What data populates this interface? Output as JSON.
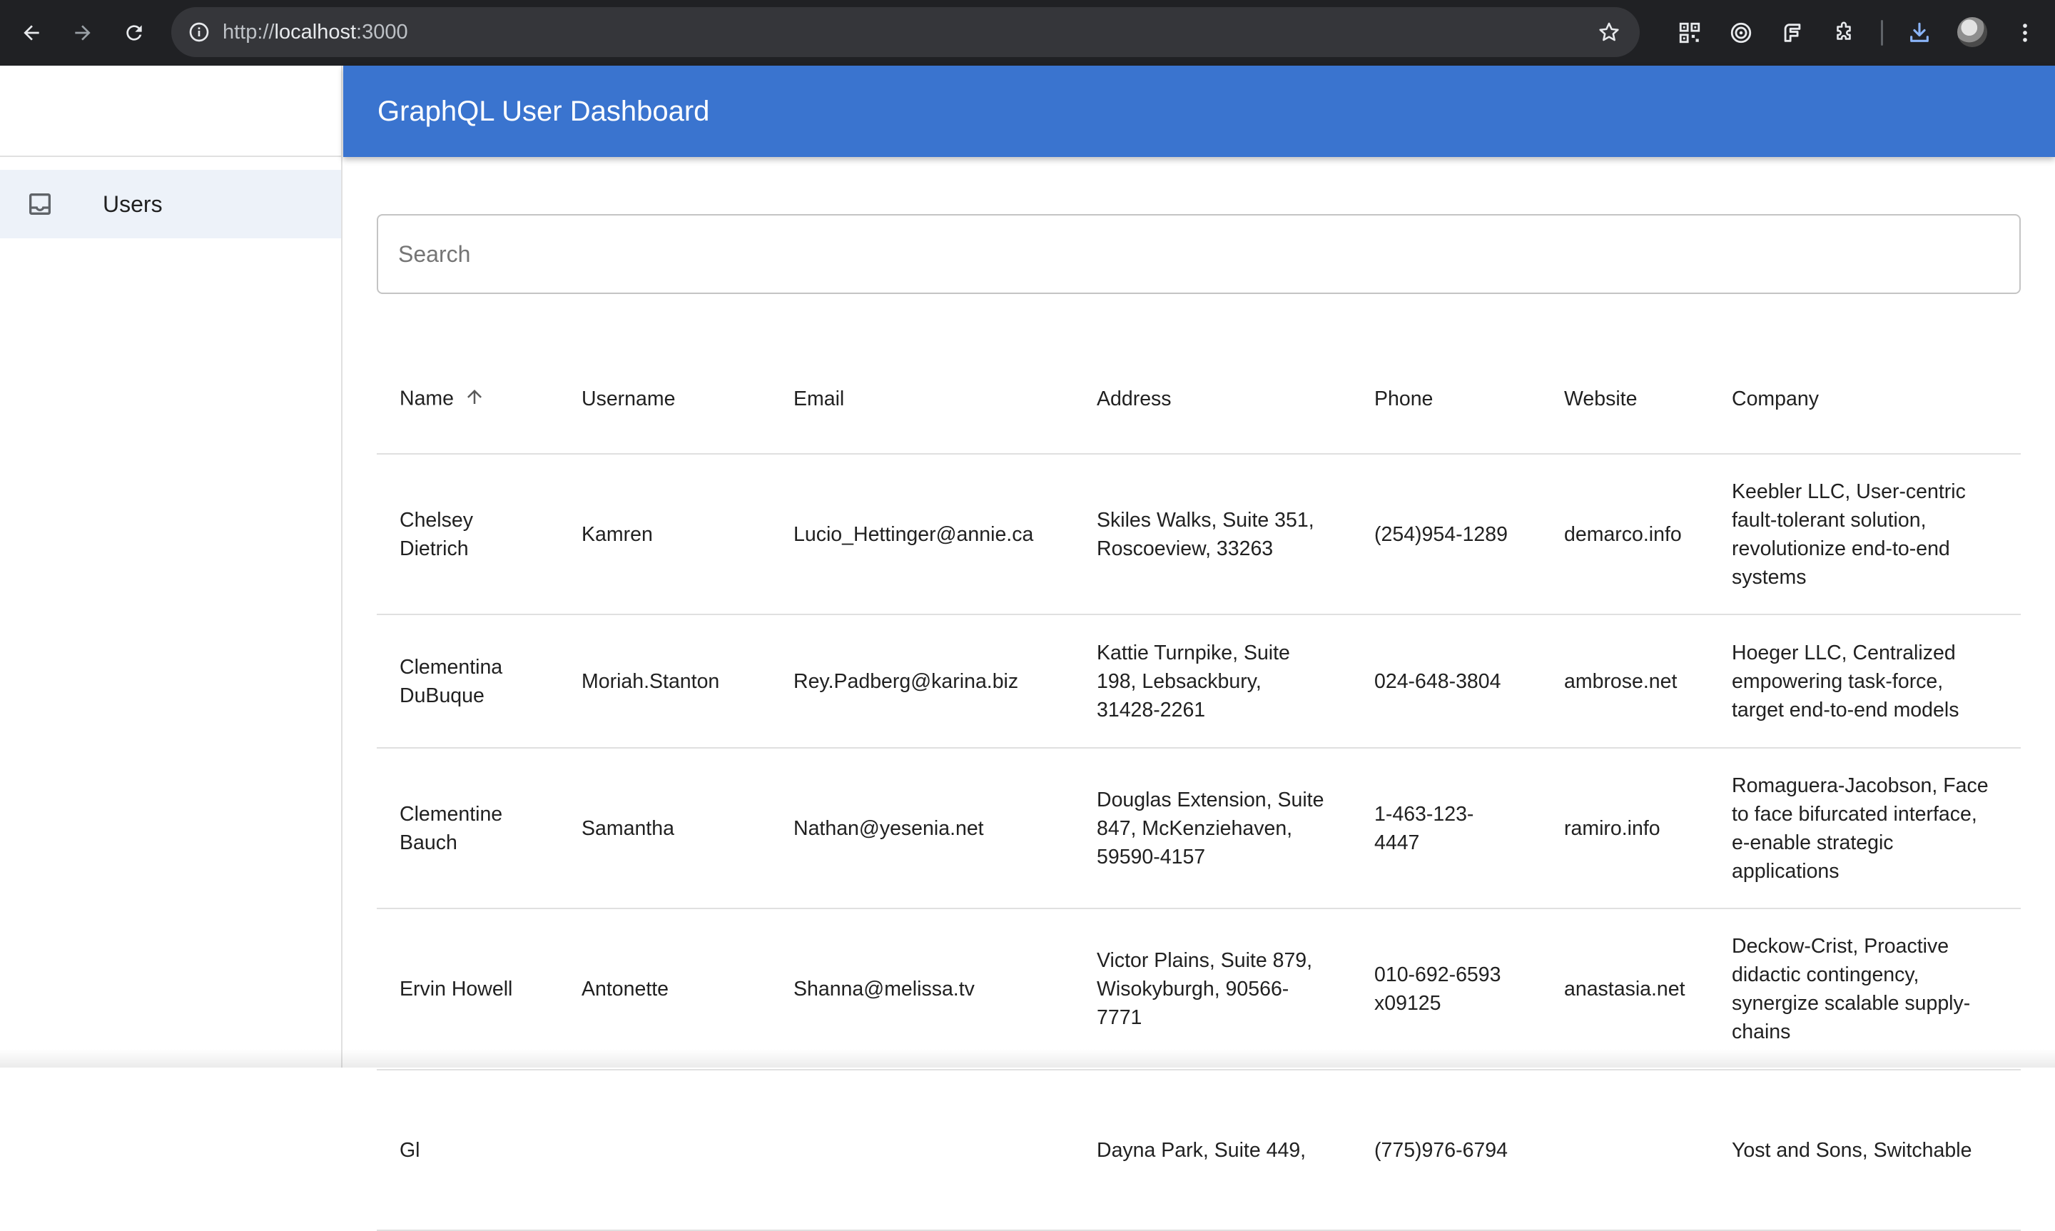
{
  "browser": {
    "url_scheme": "http://",
    "url_host": "localhost",
    "url_port": ":3000",
    "icons": [
      "back-arrow-icon",
      "forward-arrow-icon",
      "reload-icon",
      "site-info-icon",
      "bookmark-star-icon",
      "qr-code-icon",
      "target-extension-icon",
      "f-extension-icon",
      "puzzle-extensions-icon",
      "download-icon",
      "profile-avatar",
      "more-vert-icon"
    ]
  },
  "sidebar": {
    "items": [
      {
        "label": "Users",
        "icon": "inbox-icon",
        "selected": true
      }
    ]
  },
  "header": {
    "title": "GraphQL User Dashboard",
    "color": "#3a74cf"
  },
  "search": {
    "placeholder": "Search",
    "value": ""
  },
  "table": {
    "columns": [
      "Name",
      "Username",
      "Email",
      "Address",
      "Phone",
      "Website",
      "Company"
    ],
    "sorted_column": "Name",
    "sort_direction": "ascending",
    "rows": [
      {
        "name": "Chelsey Dietrich",
        "username": "Kamren",
        "email": "Lucio_Hettinger@annie.ca",
        "address": "Skiles Walks, Suite 351, Roscoeview, 33263",
        "phone": "(254)954-1289",
        "website": "demarco.info",
        "company": "Keebler LLC, User-centric fault-tolerant solution, revolutionize end-to-end systems"
      },
      {
        "name": "Clementina DuBuque",
        "username": "Moriah.Stanton",
        "email": "Rey.Padberg@karina.biz",
        "address": "Kattie Turnpike, Suite 198, Lebsackbury, 31428-2261",
        "phone": "024-648-3804",
        "website": "ambrose.net",
        "company": "Hoeger LLC, Centralized empowering task-force, target end-to-end models"
      },
      {
        "name": "Clementine Bauch",
        "username": "Samantha",
        "email": "Nathan@yesenia.net",
        "address": "Douglas Extension, Suite 847, McKenziehaven, 59590-4157",
        "phone": "1-463-123-4447",
        "website": "ramiro.info",
        "company": "Romaguera-Jacobson, Face to face bifurcated interface, e-enable strategic applications"
      },
      {
        "name": "Ervin Howell",
        "username": "Antonette",
        "email": "Shanna@melissa.tv",
        "address": "Victor Plains, Suite 879, Wisokyburgh, 90566-7771",
        "phone": "010-692-6593 x09125",
        "website": "anastasia.net",
        "company": "Deckow-Crist, Proactive didactic contingency, synergize scalable supply-chains"
      },
      {
        "name": "Gl",
        "username": "",
        "email": "",
        "address": "Dayna Park, Suite 449,",
        "phone": "(775)976-6794",
        "website": "",
        "company": "Yost and Sons, Switchable"
      }
    ]
  }
}
